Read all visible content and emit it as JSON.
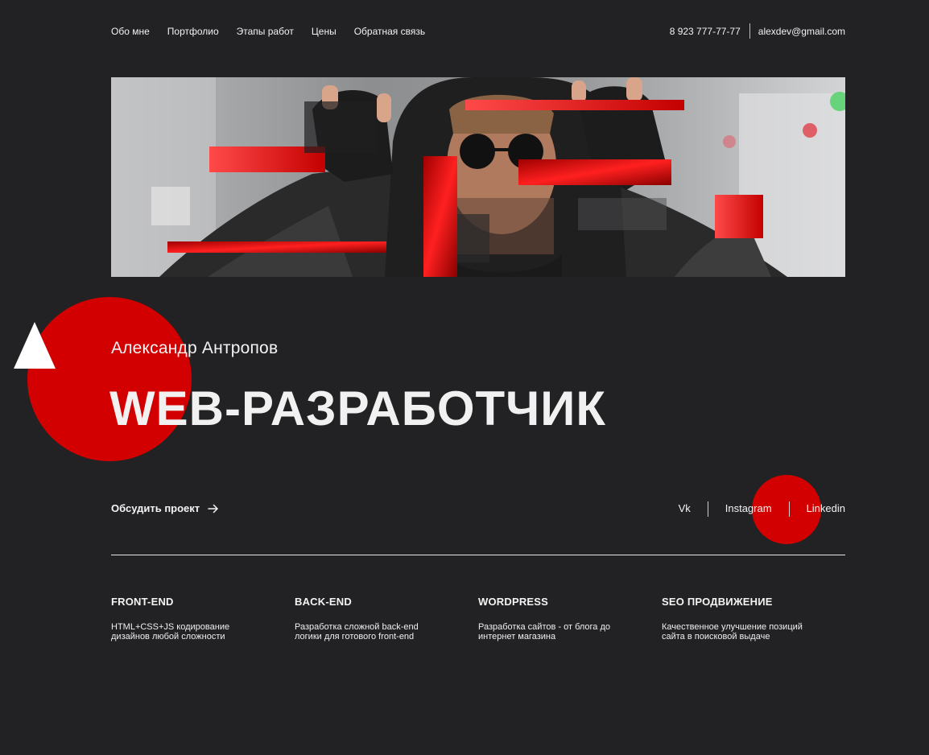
{
  "header": {
    "nav": [
      "Обо мне",
      "Портфолио",
      "Этапы работ",
      "Цены",
      "Обратная связь"
    ],
    "phone": "8 923 777-77-77",
    "email": "alexdev@gmail.com"
  },
  "hero": {
    "image_icon": "portrait-photo-glitch"
  },
  "intro": {
    "name": "Александр Антропов",
    "title": "WEB-РАЗРАБОТЧИК"
  },
  "cta": {
    "label": "Обсудить проект",
    "icon": "arrow-right-icon"
  },
  "socials": [
    "Vk",
    "Instagram",
    "Linkedin"
  ],
  "services": [
    {
      "title": "FRONT-END",
      "text": "HTML+CSS+JS кодирование дизайнов любой сложности"
    },
    {
      "title": "BACK-END",
      "text": "Разработка сложной back-end логики для готового front-end"
    },
    {
      "title": "WORDPRESS",
      "text": "Разработка сайтов - от блога до интернет магазина"
    },
    {
      "title": "SEO ПРОДВИЖЕНИЕ",
      "text": "Качественное улучшение позиций сайта в поисковой выдаче"
    }
  ],
  "colors": {
    "background": "#222224",
    "accent": "#d20000",
    "text": "#f2f2f2"
  }
}
